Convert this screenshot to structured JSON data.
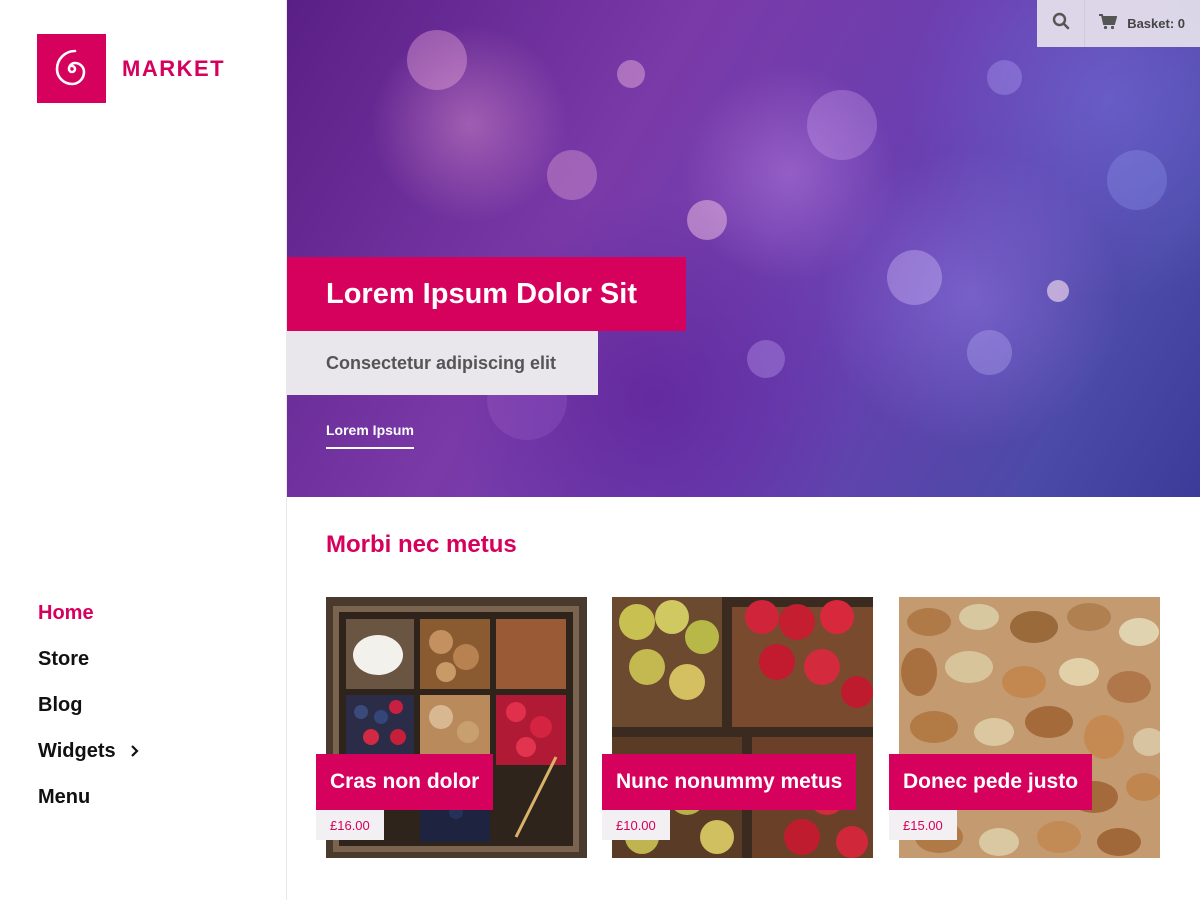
{
  "brand": {
    "name": "MARKET",
    "logo_icon": "spiral-logo-icon",
    "accent": "#d6005d"
  },
  "nav": {
    "items": [
      {
        "label": "Home",
        "active": true
      },
      {
        "label": "Store",
        "active": false
      },
      {
        "label": "Blog",
        "active": false
      },
      {
        "label": "Widgets",
        "active": false,
        "has_submenu": true
      },
      {
        "label": "Menu",
        "active": false
      }
    ]
  },
  "header": {
    "search_icon": "search-icon",
    "basket_icon": "cart-icon",
    "basket_label": "Basket: 0"
  },
  "hero": {
    "title": "Lorem Ipsum Dolor Sit",
    "subtitle": "Consectetur adipiscing elit",
    "link": "Lorem Ipsum"
  },
  "products": {
    "section_title": "Morbi nec metus",
    "items": [
      {
        "name": "Cras non dolor",
        "price": "£16.00",
        "image": "wooden-box-of-dairy-nuts-berries"
      },
      {
        "name": "Nunc nonummy metus",
        "price": "£10.00",
        "image": "baskets-of-apples"
      },
      {
        "name": "Donec pede justo",
        "price": "£15.00",
        "image": "mixed-nuts"
      }
    ]
  }
}
